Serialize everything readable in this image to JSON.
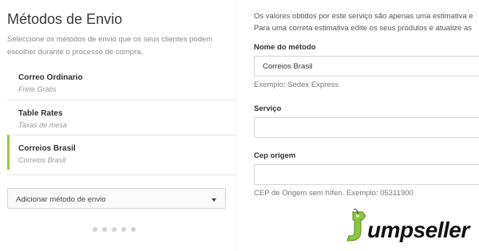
{
  "left": {
    "title": "Métodos de Envio",
    "description": "Seleccione os métodos de envio que os seus clientes podem escolher durante o processo de compra.",
    "methods": [
      {
        "name": "Correo Ordinario",
        "subtitle": "Frete Grátis"
      },
      {
        "name": "Table Rates",
        "subtitle": "Taxas de mesa"
      },
      {
        "name": "Correios Brasil",
        "subtitle": "Correios Brasil",
        "active": true
      }
    ],
    "add_method_label": "Adicionar método de envio",
    "pagination_dots": 5
  },
  "right": {
    "info_line1": "Os valores obtidos por este serviço são apenas uma estimativa e",
    "info_line2": "Para uma correta estimativa edite os seus produtos e atualize as",
    "method_name": {
      "label": "Nome do método",
      "value": "Correios Brasil",
      "hint": "Exemplo: Sedex Express"
    },
    "service": {
      "label": "Serviço",
      "value": ""
    },
    "origin_zip": {
      "label": "Cep origem",
      "value": "",
      "hint": "CEP de Origem sem hífen. Exemplo: 05311900"
    }
  },
  "logo": {
    "text": "umpseller",
    "brand_letter": "j"
  },
  "colors": {
    "accent": "#9fcb3a",
    "logo_green": "#8cc63f"
  }
}
